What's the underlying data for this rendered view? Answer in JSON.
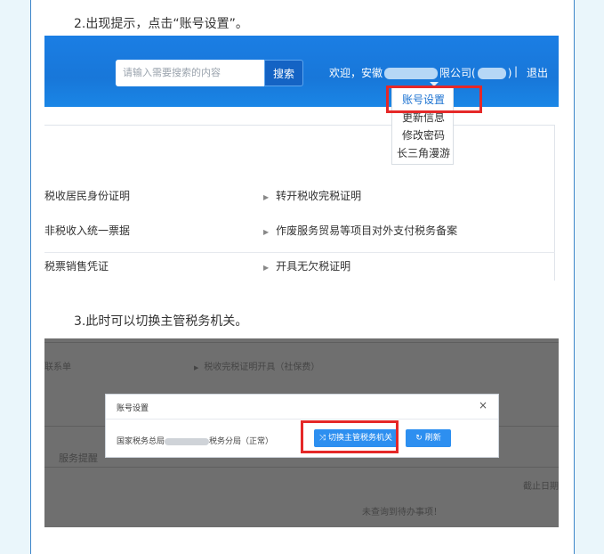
{
  "steps": {
    "step2": "2.出现提示，点击“账号设置”。",
    "step3": "3.此时可以切换主管税务机关。"
  },
  "shot1": {
    "search": {
      "placeholder": "请输入需要搜索的内容",
      "button": "搜索"
    },
    "header": {
      "welcome_prefix": "欢迎，安徽",
      "company_suffix": "限公司(",
      "close_paren": ")",
      "separator": "|",
      "logout": "退出"
    },
    "dropdown": {
      "items": [
        "账号设置",
        "更新信息",
        "修改密码",
        "长三角漫游"
      ]
    },
    "services": {
      "left": [
        "税收居民身份证明",
        "非税收入统一票据",
        "税票销售凭证"
      ],
      "right": [
        "转开税收完税证明",
        "作废服务贸易等项目对外支付税务备案",
        "开具无欠税证明"
      ]
    },
    "colors": {
      "topbar": "#1877d9",
      "highlight": "#e52828",
      "active_link": "#1b72d1"
    }
  },
  "shot2": {
    "background": {
      "row1_right": "税收完税证明开具（社保费）",
      "row1_left": "联系单",
      "tab": "服务提醒",
      "col_header": "截止日期",
      "empty_msg": "未查询到待办事项！"
    },
    "modal": {
      "title": "账号设置",
      "close": "×",
      "org_prefix": "国家税务总局",
      "org_suffix": "税务分局（正常）",
      "switch_button": "切换主管税务机关",
      "switch_icon": "shuffle-icon",
      "refresh_button": "刷新",
      "refresh_icon": "refresh-icon"
    }
  }
}
